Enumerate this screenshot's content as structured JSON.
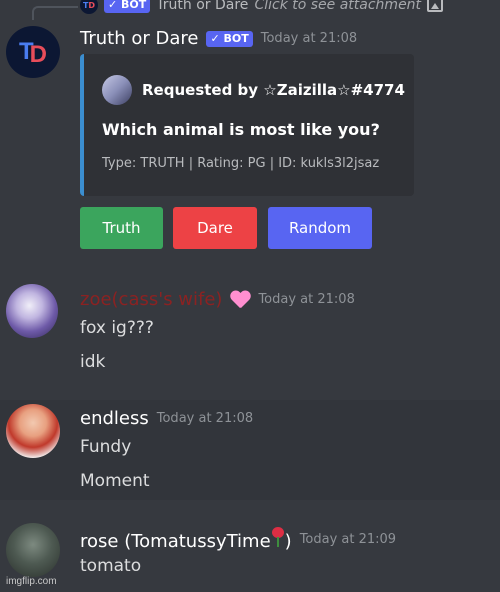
{
  "reply": {
    "bot_tag": "✓ BOT",
    "name": "Truth or Dare",
    "hint": "Click to see attachment",
    "icon": "image-icon"
  },
  "messages": [
    {
      "username": "Truth or Dare",
      "bot_tag": "✓ BOT",
      "timestamp": "Today at 21:08",
      "avatar_text": [
        "T",
        "D"
      ],
      "embed": {
        "author": "Requested by ☆Zaizilla☆#4774",
        "title": "Which animal is most like you?",
        "footer": "Type: TRUTH | Rating: PG | ID: kukls3l2jsaz",
        "accent_color": "#3b8ed0"
      },
      "buttons": [
        {
          "label": "Truth",
          "color": "#3ba55d"
        },
        {
          "label": "Dare",
          "color": "#ed4245"
        },
        {
          "label": "Random",
          "color": "#5865f2"
        }
      ]
    },
    {
      "username": "zoe(cass's wife)",
      "name_color": "#8b2222",
      "badge": "sparkling-heart-icon",
      "timestamp": "Today at 21:08",
      "lines": [
        "fox ig???",
        "idk"
      ]
    },
    {
      "username": "endless",
      "timestamp": "Today at 21:08",
      "lines": [
        "Fundy",
        "Moment"
      ]
    },
    {
      "username": "rose (TomatussyTime",
      "username_suffix": ")",
      "badge": "rose-icon",
      "timestamp": "Today at 21:09",
      "lines": [
        "tomato"
      ]
    }
  ],
  "watermark": "imgflip.com"
}
